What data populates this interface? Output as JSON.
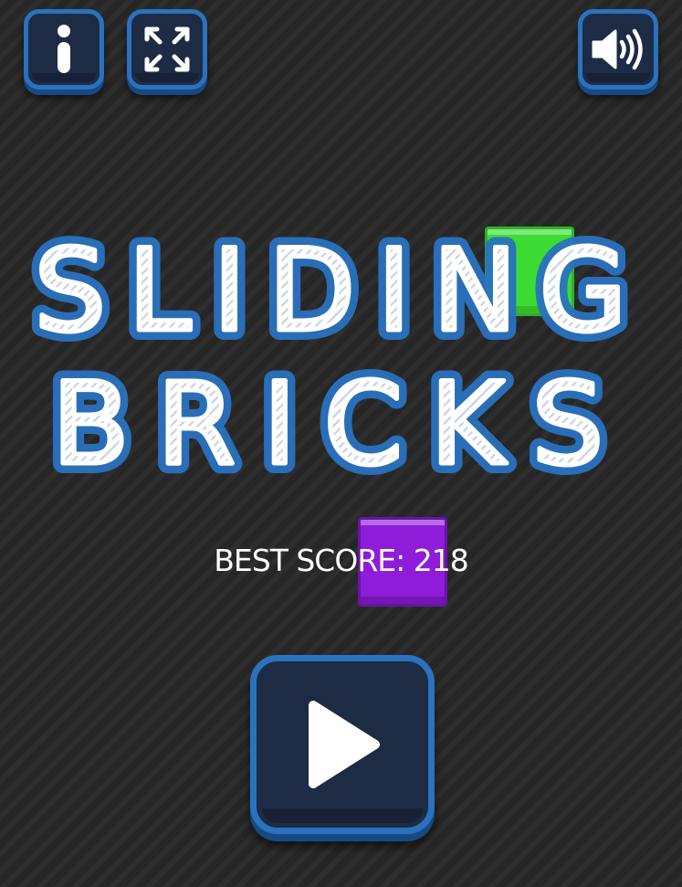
{
  "game": {
    "title_line1": "SLIDING",
    "title_line2": "BRICKS",
    "best_score_label": "BEST SCORE:",
    "best_score_value": "218"
  },
  "buttons": {
    "info_icon": "info-icon",
    "fullscreen_icon": "fullscreen-icon",
    "sound_icon": "speaker-icon",
    "play_icon": "play-icon"
  },
  "colors": {
    "background": "#262626",
    "button_fill": "#1d2b45",
    "button_border": "#2a72bf",
    "title_glow": "#2a72bf",
    "brick_green": "#3ddc34",
    "brick_purple": "#8e1cd8"
  }
}
